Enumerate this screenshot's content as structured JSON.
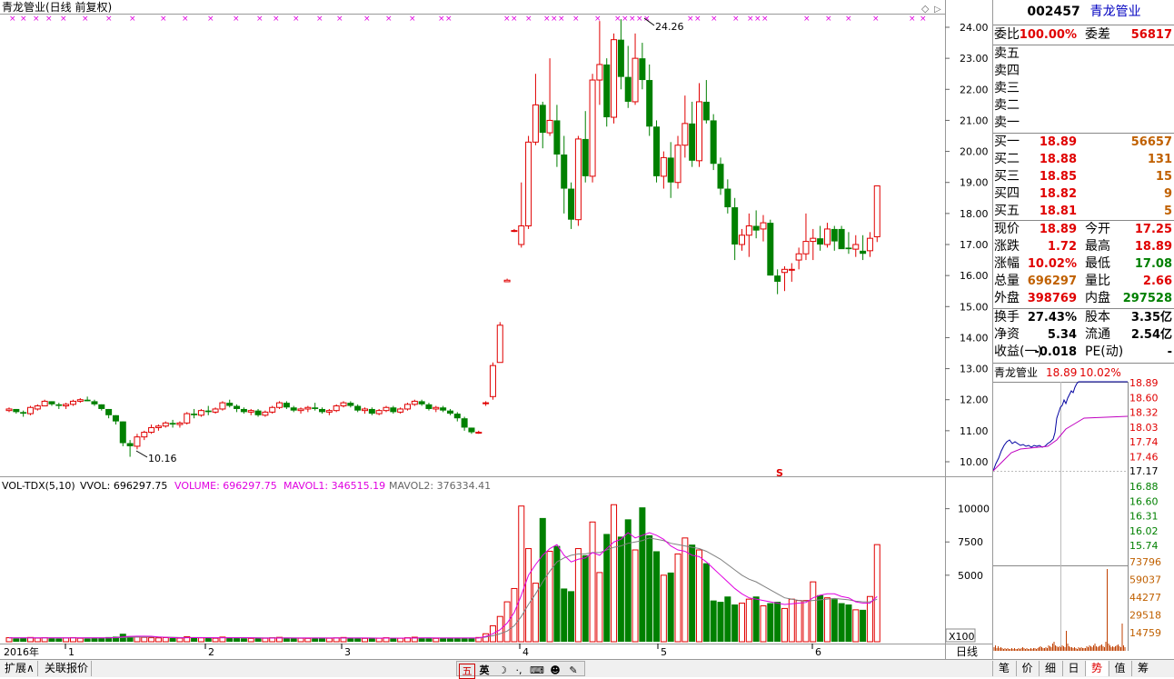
{
  "chart_title": "青龙管业(日线 前复权)",
  "price_axis": {
    "ticks": [
      "24.00",
      "23.00",
      "22.00",
      "21.00",
      "20.00",
      "19.00",
      "18.00",
      "17.00",
      "16.00",
      "15.00",
      "14.00",
      "13.00",
      "12.00",
      "11.00",
      "10.00"
    ]
  },
  "max_label": "24.26",
  "min_label": "10.16",
  "s_marker": "S",
  "vol_indicator": {
    "name": "VOL-TDX(5,10)",
    "vvol": "VVOL: 696297.75",
    "volume": "VOLUME: 696297.75",
    "mavol1": "MAVOL1: 346515.19",
    "mavol2": "MAVOL2: 376334.41"
  },
  "vol_axis": {
    "ticks": [
      "10000",
      "7500",
      "5000"
    ],
    "unit": "X100"
  },
  "x_axis": {
    "year": "2016年",
    "months": [
      "1",
      "2",
      "3",
      "4",
      "5",
      "6"
    ]
  },
  "chart_data": {
    "type": "candlestick",
    "ylim": [
      9.7,
      24.5
    ],
    "colors": {
      "up": "#e00000",
      "down": "#008000",
      "ma1": "#e000e0",
      "ma2": "#808080"
    },
    "candles": [
      [
        11.65,
        11.75,
        11.6,
        11.7
      ],
      [
        11.7,
        11.7,
        11.55,
        11.6
      ],
      [
        11.6,
        11.65,
        11.45,
        11.55
      ],
      [
        11.55,
        11.8,
        11.5,
        11.75
      ],
      [
        11.7,
        11.85,
        11.65,
        11.8
      ],
      [
        11.8,
        12.0,
        11.8,
        11.95
      ],
      [
        11.95,
        11.95,
        11.8,
        11.85
      ],
      [
        11.85,
        11.9,
        11.7,
        11.8
      ],
      [
        11.8,
        11.9,
        11.7,
        11.85
      ],
      [
        11.85,
        12.0,
        11.8,
        11.95
      ],
      [
        11.95,
        12.05,
        11.9,
        12.0
      ],
      [
        12.0,
        12.1,
        11.95,
        11.95
      ],
      [
        11.95,
        12.0,
        11.8,
        11.85
      ],
      [
        11.85,
        11.85,
        11.65,
        11.7
      ],
      [
        11.7,
        11.7,
        11.4,
        11.5
      ],
      [
        11.5,
        11.5,
        11.2,
        11.3
      ],
      [
        11.3,
        11.3,
        10.5,
        10.6
      ],
      [
        10.6,
        10.7,
        10.16,
        10.5
      ],
      [
        10.5,
        10.9,
        10.4,
        10.8
      ],
      [
        10.8,
        11.0,
        10.7,
        10.95
      ],
      [
        10.95,
        11.2,
        10.9,
        11.1
      ],
      [
        11.1,
        11.2,
        11.0,
        11.15
      ],
      [
        11.15,
        11.3,
        11.1,
        11.25
      ],
      [
        11.25,
        11.35,
        11.1,
        11.2
      ],
      [
        11.2,
        11.3,
        11.1,
        11.25
      ],
      [
        11.25,
        11.6,
        11.2,
        11.55
      ],
      [
        11.55,
        11.7,
        11.4,
        11.5
      ],
      [
        11.5,
        11.7,
        11.45,
        11.65
      ],
      [
        11.65,
        11.8,
        11.5,
        11.6
      ],
      [
        11.6,
        11.75,
        11.55,
        11.7
      ],
      [
        11.7,
        11.95,
        11.65,
        11.9
      ],
      [
        11.9,
        12.0,
        11.75,
        11.8
      ],
      [
        11.8,
        11.85,
        11.6,
        11.7
      ],
      [
        11.7,
        11.75,
        11.55,
        11.6
      ],
      [
        11.6,
        11.7,
        11.5,
        11.65
      ],
      [
        11.65,
        11.7,
        11.45,
        11.5
      ],
      [
        11.5,
        11.65,
        11.45,
        11.6
      ],
      [
        11.6,
        11.8,
        11.55,
        11.75
      ],
      [
        11.75,
        11.95,
        11.7,
        11.9
      ],
      [
        11.9,
        11.95,
        11.7,
        11.75
      ],
      [
        11.75,
        11.8,
        11.6,
        11.65
      ],
      [
        11.65,
        11.75,
        11.55,
        11.7
      ],
      [
        11.7,
        11.8,
        11.6,
        11.75
      ],
      [
        11.75,
        11.9,
        11.65,
        11.7
      ],
      [
        11.7,
        11.75,
        11.55,
        11.6
      ],
      [
        11.6,
        11.7,
        11.5,
        11.65
      ],
      [
        11.65,
        11.85,
        11.6,
        11.8
      ],
      [
        11.8,
        11.95,
        11.75,
        11.9
      ],
      [
        11.9,
        11.95,
        11.75,
        11.8
      ],
      [
        11.8,
        11.85,
        11.6,
        11.65
      ],
      [
        11.65,
        11.75,
        11.55,
        11.7
      ],
      [
        11.7,
        11.75,
        11.5,
        11.55
      ],
      [
        11.55,
        11.7,
        11.5,
        11.65
      ],
      [
        11.65,
        11.8,
        11.6,
        11.75
      ],
      [
        11.75,
        11.8,
        11.55,
        11.6
      ],
      [
        11.6,
        11.75,
        11.55,
        11.7
      ],
      [
        11.7,
        11.9,
        11.65,
        11.85
      ],
      [
        11.85,
        12.0,
        11.8,
        11.95
      ],
      [
        11.95,
        12.0,
        11.8,
        11.85
      ],
      [
        11.85,
        11.9,
        11.65,
        11.7
      ],
      [
        11.7,
        11.8,
        11.6,
        11.75
      ],
      [
        11.75,
        11.8,
        11.6,
        11.65
      ],
      [
        11.65,
        11.7,
        11.5,
        11.55
      ],
      [
        11.55,
        11.6,
        11.3,
        11.4
      ],
      [
        11.4,
        11.45,
        11.0,
        11.1
      ],
      [
        11.1,
        11.1,
        10.9,
        10.95
      ],
      [
        10.95,
        11.0,
        10.9,
        10.95
      ],
      [
        11.9,
        11.95,
        11.8,
        11.9
      ],
      [
        12.1,
        13.2,
        12.0,
        13.1
      ],
      [
        13.2,
        14.5,
        13.2,
        14.4
      ],
      [
        15.8,
        15.9,
        15.8,
        15.85
      ],
      [
        17.45,
        17.5,
        17.4,
        17.45
      ],
      [
        17.0,
        19.0,
        16.9,
        17.6
      ],
      [
        17.6,
        20.5,
        17.5,
        20.3
      ],
      [
        20.3,
        22.5,
        20.2,
        21.5
      ],
      [
        21.5,
        21.6,
        20.1,
        20.6
      ],
      [
        20.6,
        23.0,
        20.5,
        21.0
      ],
      [
        21.0,
        21.5,
        19.5,
        19.9
      ],
      [
        19.9,
        20.5,
        18.0,
        18.8
      ],
      [
        18.8,
        19.0,
        17.5,
        17.8
      ],
      [
        17.8,
        20.5,
        17.6,
        20.4
      ],
      [
        20.4,
        21.3,
        19.0,
        19.2
      ],
      [
        19.2,
        22.5,
        19.0,
        22.3
      ],
      [
        22.3,
        24.2,
        21.5,
        22.8
      ],
      [
        22.8,
        23.0,
        20.8,
        21.1
      ],
      [
        21.1,
        23.8,
        20.9,
        23.6
      ],
      [
        23.6,
        24.26,
        22.0,
        22.4
      ],
      [
        22.4,
        23.4,
        21.4,
        21.6
      ],
      [
        21.6,
        23.8,
        21.5,
        23.0
      ],
      [
        23.0,
        23.5,
        22.0,
        22.3
      ],
      [
        22.3,
        22.8,
        20.5,
        20.8
      ],
      [
        20.8,
        21.0,
        19.0,
        19.2
      ],
      [
        19.2,
        20.0,
        18.8,
        19.8
      ],
      [
        19.8,
        20.3,
        18.5,
        19.0
      ],
      [
        19.0,
        20.5,
        18.8,
        20.2
      ],
      [
        20.2,
        21.8,
        19.8,
        20.9
      ],
      [
        20.9,
        21.6,
        19.5,
        19.7
      ],
      [
        19.7,
        22.2,
        19.5,
        21.6
      ],
      [
        21.6,
        22.3,
        20.9,
        21.0
      ],
      [
        21.0,
        21.2,
        19.4,
        19.6
      ],
      [
        19.6,
        19.8,
        18.6,
        18.8
      ],
      [
        18.8,
        19.1,
        18.0,
        18.2
      ],
      [
        18.2,
        18.5,
        16.5,
        17.0
      ],
      [
        17.0,
        17.5,
        16.8,
        17.3
      ],
      [
        17.3,
        18.0,
        16.6,
        17.6
      ],
      [
        17.6,
        18.1,
        17.2,
        17.45
      ],
      [
        17.5,
        17.95,
        17.1,
        17.7
      ],
      [
        17.7,
        17.8,
        16.0,
        16.0
      ],
      [
        16.0,
        16.2,
        15.4,
        15.8
      ],
      [
        16.1,
        16.3,
        15.5,
        16.2
      ],
      [
        16.2,
        16.4,
        15.8,
        16.2
      ],
      [
        16.5,
        16.9,
        16.2,
        16.7
      ],
      [
        16.7,
        18.0,
        16.5,
        17.1
      ],
      [
        17.1,
        17.5,
        16.5,
        17.2
      ],
      [
        17.2,
        17.6,
        16.8,
        17.0
      ],
      [
        17.0,
        17.7,
        16.9,
        17.5
      ],
      [
        17.5,
        17.6,
        16.8,
        17.1
      ],
      [
        17.5,
        17.6,
        16.9,
        16.85
      ],
      [
        16.9,
        17.4,
        16.7,
        16.85
      ],
      [
        16.85,
        17.3,
        16.6,
        17.0
      ],
      [
        16.8,
        17.3,
        16.5,
        16.7
      ],
      [
        16.8,
        17.4,
        16.6,
        17.2
      ],
      [
        17.25,
        18.89,
        17.08,
        18.89
      ]
    ],
    "volumes": [
      300,
      250,
      280,
      320,
      270,
      300,
      260,
      240,
      280,
      310,
      260,
      240,
      270,
      290,
      350,
      380,
      600,
      420,
      360,
      330,
      300,
      290,
      310,
      280,
      270,
      380,
      320,
      290,
      280,
      260,
      350,
      320,
      280,
      260,
      250,
      280,
      260,
      300,
      330,
      290,
      270,
      260,
      250,
      300,
      280,
      260,
      290,
      320,
      280,
      260,
      250,
      280,
      260,
      300,
      270,
      260,
      300,
      340,
      280,
      260,
      250,
      270,
      260,
      300,
      280,
      260,
      320,
      600,
      1200,
      1900,
      3000,
      4000,
      10200,
      7000,
      4400,
      9300,
      6800,
      7200,
      4000,
      3800,
      7000,
      6500,
      9000,
      5200,
      8100,
      10300,
      7900,
      9200,
      6900,
      10100,
      8000,
      6800,
      5000,
      5200,
      6600,
      7800,
      7300,
      6900,
      5900,
      3100,
      3000,
      3400,
      2800,
      2900,
      3200,
      3400,
      2700,
      2900,
      3000,
      2500,
      3200,
      3100,
      3100,
      4500,
      3500,
      3300,
      3200,
      2900,
      2800,
      2400,
      2400,
      3400,
      7300
    ],
    "ma1": [
      290,
      290,
      290,
      290,
      290,
      290,
      290,
      290,
      290,
      290,
      290,
      290,
      290,
      290,
      290,
      320,
      370,
      400,
      420,
      420,
      410,
      360,
      330,
      310,
      290,
      300,
      310,
      310,
      300,
      300,
      300,
      300,
      300,
      300,
      300,
      280,
      270,
      270,
      280,
      280,
      280,
      280,
      280,
      280,
      280,
      280,
      280,
      280,
      280,
      280,
      280,
      270,
      270,
      270,
      270,
      270,
      270,
      280,
      290,
      290,
      280,
      280,
      280,
      280,
      280,
      280,
      280,
      400,
      600,
      900,
      1400,
      2200,
      3500,
      5000,
      5800,
      6500,
      7000,
      7300,
      6500,
      6000,
      6200,
      6300,
      6700,
      6500,
      7000,
      7500,
      7700,
      8200,
      7800,
      8000,
      8200,
      8000,
      7700,
      7200,
      6900,
      6800,
      6500,
      6400,
      6000,
      5500,
      5000,
      4500,
      4000,
      3600,
      3300,
      3200,
      3100,
      3000,
      2900,
      2800,
      2850,
      2900,
      2950,
      3300,
      3500,
      3600,
      3600,
      3400,
      3300,
      3000,
      2900,
      2900,
      3400
    ],
    "ma2": [
      290,
      290,
      290,
      290,
      290,
      290,
      290,
      290,
      290,
      290,
      290,
      290,
      290,
      290,
      290,
      300,
      320,
      340,
      350,
      360,
      360,
      350,
      340,
      330,
      320,
      320,
      320,
      320,
      310,
      300,
      300,
      300,
      300,
      300,
      300,
      290,
      290,
      290,
      290,
      290,
      280,
      280,
      280,
      280,
      280,
      280,
      280,
      280,
      280,
      280,
      280,
      280,
      270,
      270,
      270,
      270,
      270,
      270,
      280,
      280,
      280,
      280,
      280,
      280,
      280,
      280,
      280,
      350,
      450,
      600,
      800,
      1200,
      1900,
      2800,
      3600,
      4500,
      5300,
      6000,
      6300,
      6500,
      6600,
      6600,
      6700,
      6700,
      6900,
      7100,
      7200,
      7400,
      7500,
      7600,
      7800,
      7700,
      7600,
      7400,
      7300,
      7200,
      7100,
      7000,
      6800,
      6500,
      6200,
      5800,
      5400,
      5000,
      4700,
      4500,
      4200,
      3900,
      3600,
      3300,
      3200,
      3100,
      3050,
      3100,
      3150,
      3200,
      3250,
      3200,
      3150,
      3050,
      3000,
      3000,
      3200
    ],
    "vylim": [
      0,
      11000
    ]
  },
  "quote": {
    "code": "002457",
    "name": "青龙管业",
    "wb_label": "委比",
    "wb_value": "100.00%",
    "wc_label": "委差",
    "wc_value": "56817",
    "sell": [
      {
        "label": "卖五"
      },
      {
        "label": "卖四"
      },
      {
        "label": "卖三"
      },
      {
        "label": "卖二"
      },
      {
        "label": "卖一"
      }
    ],
    "buy": [
      {
        "label": "买一",
        "price": "18.89",
        "vol": "56657"
      },
      {
        "label": "买二",
        "price": "18.88",
        "vol": "131"
      },
      {
        "label": "买三",
        "price": "18.85",
        "vol": "15"
      },
      {
        "label": "买四",
        "price": "18.82",
        "vol": "9"
      },
      {
        "label": "买五",
        "price": "18.81",
        "vol": "5"
      }
    ],
    "stats": [
      {
        "l1": "现价",
        "v1": "18.89",
        "c1": "#e00000",
        "l2": "今开",
        "v2": "17.25",
        "c2": "#e00000"
      },
      {
        "l1": "涨跌",
        "v1": "1.72",
        "c1": "#e00000",
        "l2": "最高",
        "v2": "18.89",
        "c2": "#e00000"
      },
      {
        "l1": "涨幅",
        "v1": "10.02%",
        "c1": "#e00000",
        "l2": "最低",
        "v2": "17.08",
        "c2": "#008000"
      },
      {
        "l1": "总量",
        "v1": "696297",
        "c1": "#c06000",
        "l2": "量比",
        "v2": "2.66",
        "c2": "#e00000"
      },
      {
        "l1": "外盘",
        "v1": "398769",
        "c1": "#e00000",
        "l2": "内盘",
        "v2": "297528",
        "c2": "#008000"
      }
    ],
    "stats2": [
      {
        "l1": "换手",
        "v1": "27.43%",
        "l2": "股本",
        "v2": "3.35亿"
      },
      {
        "l1": "净资",
        "v1": "5.34",
        "l2": "流通",
        "v2": "2.54亿"
      },
      {
        "l1": "收益(一)",
        "v1": "-0.018",
        "l2": "PE(动)",
        "v2": "-"
      }
    ]
  },
  "mini": {
    "title": "青龙管业",
    "price": "18.89",
    "pct": "10.02%",
    "price_ticks_up": [
      "18.89",
      "18.60",
      "18.32",
      "18.03",
      "17.74",
      "17.46"
    ],
    "price_mid": "17.17",
    "price_ticks_down": [
      "16.88",
      "16.60",
      "16.31",
      "16.02",
      "15.74"
    ],
    "vol_ticks": [
      "73796",
      "59037",
      "44277",
      "29518",
      "14759"
    ]
  },
  "bottom": {
    "left_tabs": [
      "扩展∧",
      "关联报价"
    ],
    "x_label": "日线",
    "tool_labels": [
      "五",
      "英"
    ],
    "right_tabs": [
      "笔",
      "价",
      "细",
      "日",
      "势",
      "值",
      "筹"
    ],
    "active_tab": "势"
  }
}
